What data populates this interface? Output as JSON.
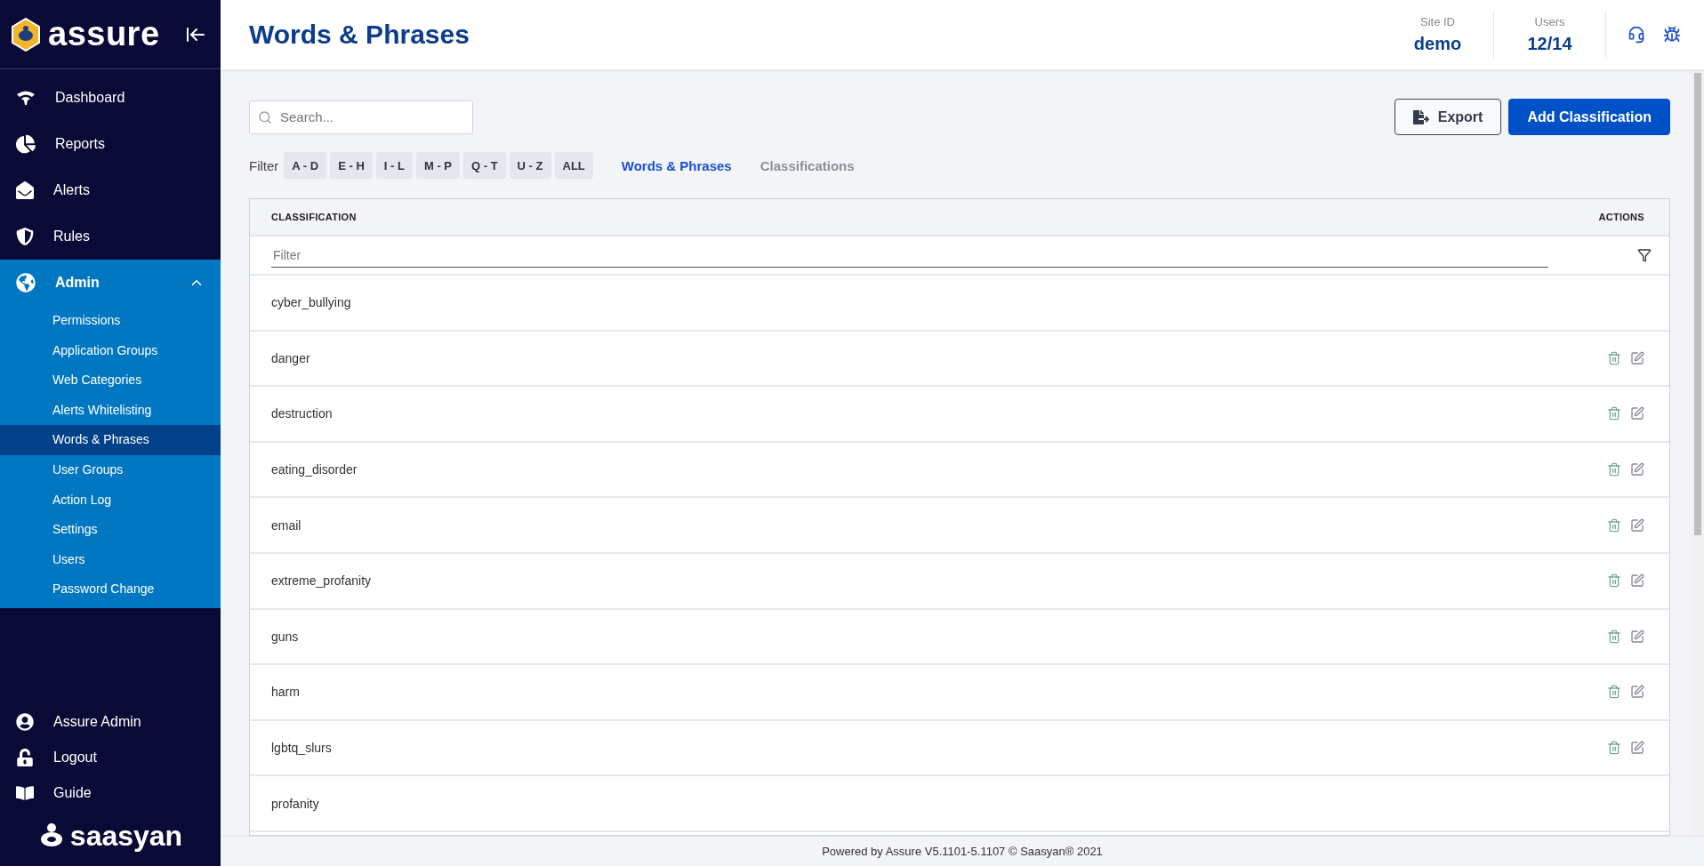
{
  "sidebar": {
    "logo": "assure",
    "nav": [
      {
        "label": "Dashboard",
        "kind": "dashboard"
      },
      {
        "label": "Reports",
        "kind": "reports"
      },
      {
        "label": "Alerts",
        "kind": "alerts"
      },
      {
        "label": "Rules",
        "kind": "rules"
      },
      {
        "label": "Admin",
        "kind": "admin",
        "expanded": true,
        "children": [
          {
            "label": "Permissions",
            "selected": false
          },
          {
            "label": "Application Groups",
            "selected": false
          },
          {
            "label": "Web Categories",
            "selected": false
          },
          {
            "label": "Alerts Whitelisting",
            "selected": false
          },
          {
            "label": "Words & Phrases",
            "selected": true
          },
          {
            "label": "User Groups",
            "selected": false
          },
          {
            "label": "Action Log",
            "selected": false
          },
          {
            "label": "Settings",
            "selected": false
          },
          {
            "label": "Users",
            "selected": false
          },
          {
            "label": "Password Change",
            "selected": false
          }
        ]
      }
    ],
    "bottom": [
      {
        "label": "Assure Admin",
        "kind": "user"
      },
      {
        "label": "Logout",
        "kind": "logout"
      },
      {
        "label": "Guide",
        "kind": "guide"
      }
    ],
    "brand": "saasyan"
  },
  "header": {
    "title": "Words & Phrases",
    "stats": [
      {
        "label": "Site ID",
        "value": "demo"
      },
      {
        "label": "Users",
        "value": "12/14"
      }
    ]
  },
  "search": {
    "placeholder": "Search..."
  },
  "buttons": [
    {
      "label": "Export",
      "kind": "secondary"
    },
    {
      "label": "Add Classification",
      "kind": "primary"
    }
  ],
  "filter": {
    "label": "Filter",
    "letters": [
      "A - D",
      "E - H",
      "I - L",
      "M - P",
      "Q - T",
      "U - Z",
      "ALL"
    ],
    "views": [
      {
        "label": "Words & Phrases",
        "selected": true
      },
      {
        "label": "Classifications",
        "selected": false
      }
    ]
  },
  "table": {
    "columns": [
      "CLASSIFICATION",
      "ACTIONS"
    ],
    "filter_placeholder": "Filter",
    "rows": [
      {
        "name": "cyber_bullying",
        "actions": false
      },
      {
        "name": "danger",
        "actions": true
      },
      {
        "name": "destruction",
        "actions": true
      },
      {
        "name": "eating_disorder",
        "actions": true
      },
      {
        "name": "email",
        "actions": true
      },
      {
        "name": "extreme_profanity",
        "actions": true
      },
      {
        "name": "guns",
        "actions": true
      },
      {
        "name": "harm",
        "actions": true
      },
      {
        "name": "lgbtq_slurs",
        "actions": true
      },
      {
        "name": "profanity",
        "actions": false
      }
    ]
  },
  "footer": "Powered by Assure V5.1101-5.1107 © Saasyan® 2021"
}
